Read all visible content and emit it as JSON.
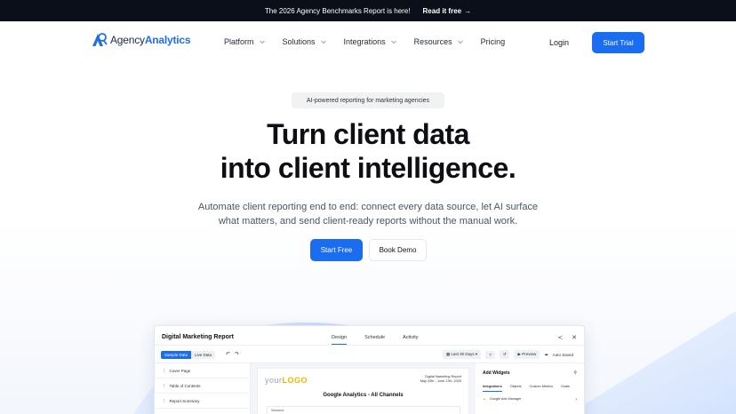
{
  "announcement": {
    "text": "The 2026 Agency Benchmarks Report is here!",
    "link_label": "Read it free",
    "link_arrow": "→"
  },
  "brand": {
    "name_part1": "Agency",
    "name_part2": "Analytics",
    "accent": "#1a6cf0"
  },
  "nav": {
    "items": [
      {
        "label": "Platform",
        "has_dropdown": true
      },
      {
        "label": "Solutions",
        "has_dropdown": true
      },
      {
        "label": "Integrations",
        "has_dropdown": true
      },
      {
        "label": "Resources",
        "has_dropdown": true
      },
      {
        "label": "Pricing",
        "has_dropdown": false
      }
    ],
    "login": "Login",
    "cta": "Start Trial"
  },
  "hero": {
    "pill": "AI-powered reporting for marketing agencies",
    "headline_line1": "Turn client data",
    "headline_line2": "into client intelligence.",
    "sub_line1": "Automate client reporting end to end: connect every data source, let AI surface",
    "sub_line2": "what matters, and send client-ready reports without the manual work.",
    "primary_cta": "Start Free",
    "secondary_cta": "Book Demo"
  },
  "app": {
    "title": "Digital Marketing Report",
    "tabs": [
      "Design",
      "Schedule",
      "Activity"
    ],
    "active_tab": "Design",
    "data_toggle": [
      "Sample Data",
      "Live Data"
    ],
    "date_range": "Last 30 Days",
    "preview": "Preview",
    "autosave": "Auto Saved",
    "sidebar": [
      "Cover Page",
      "Table of Contents",
      "Report Summary"
    ],
    "report": {
      "logo_text": "your",
      "logo_accent": "LOGO",
      "meta_title": "Digital Marketing Report",
      "meta_dates": "May 20th - June 17th, 2025",
      "section_title": "Google Analytics - All Channels",
      "box_label": "Sessions"
    },
    "widgets": {
      "title": "Add Widgets",
      "tabs": [
        "Integrations",
        "Objects",
        "Custom Metrics",
        "Goals"
      ],
      "first_item": "Google Ads Manager"
    }
  }
}
